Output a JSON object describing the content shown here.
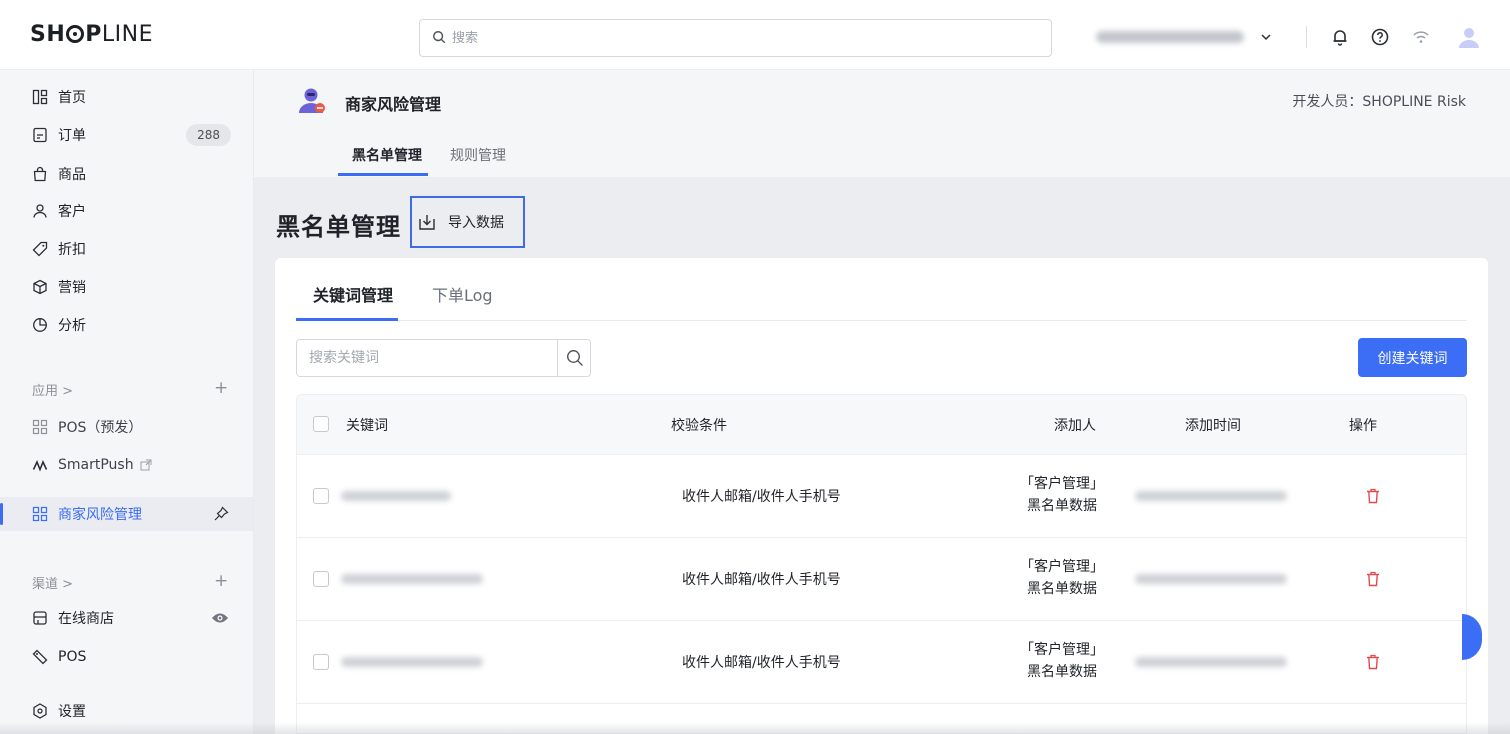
{
  "topbar": {
    "logo": {
      "prefix": "SH",
      "middle_o": "O",
      "rest_bold": "P",
      "rest_thin": "LINE"
    },
    "search_placeholder": "搜索",
    "icons": [
      "bell-icon",
      "help-icon",
      "wifi-icon",
      "user-avatar-icon"
    ]
  },
  "sidebar": {
    "items": [
      {
        "label": "首页",
        "icon": "home-icon"
      },
      {
        "label": "订单",
        "icon": "order-icon",
        "badge": "288"
      },
      {
        "label": "商品",
        "icon": "bag-icon"
      },
      {
        "label": "客户",
        "icon": "customer-icon"
      },
      {
        "label": "折扣",
        "icon": "tag-icon"
      },
      {
        "label": "营销",
        "icon": "marketing-icon"
      },
      {
        "label": "分析",
        "icon": "analytics-icon"
      }
    ],
    "apps_group": "应用 >",
    "apps": [
      {
        "label": "POS（预发）",
        "icon": "app-grid-icon"
      },
      {
        "label": "SmartPush",
        "icon": "smartpush-icon"
      },
      {
        "label": "商家风险管理",
        "icon": "app-grid-icon",
        "active": true
      }
    ],
    "channels_group": "渠道 >",
    "channels": [
      {
        "label": "在线商店",
        "icon": "store-icon"
      },
      {
        "label": "POS",
        "icon": "pos-tag-icon"
      }
    ],
    "settings": "设置"
  },
  "app_header": {
    "title": "商家风险管理",
    "developer": "开发人员：SHOPLINE Risk",
    "tabs": [
      "黑名单管理",
      "规则管理"
    ],
    "active_tab": 0
  },
  "page": {
    "title": "黑名单管理",
    "import_label": "导入数据"
  },
  "card": {
    "tabs": [
      "关键词管理",
      "下单Log"
    ],
    "search_placeholder": "搜索关键词",
    "create_button": "创建关键词",
    "columns": [
      "关键词",
      "校验条件",
      "添加人",
      "添加时间",
      "操作"
    ],
    "rows": [
      {
        "condition": "收件人邮箱/收件人手机号",
        "adder_line1": "「客户管理」",
        "adder_line2": "黑名单数据"
      },
      {
        "condition": "收件人邮箱/收件人手机号",
        "adder_line1": "「客户管理」",
        "adder_line2": "黑名单数据"
      },
      {
        "condition": "收件人邮箱/收件人手机号",
        "adder_line1": "「客户管理」",
        "adder_line2": "黑名单数据"
      }
    ]
  },
  "colors": {
    "accent": "#3b6ef5",
    "delete": "#e5484d",
    "highlight_border": "#3f6ae8"
  }
}
